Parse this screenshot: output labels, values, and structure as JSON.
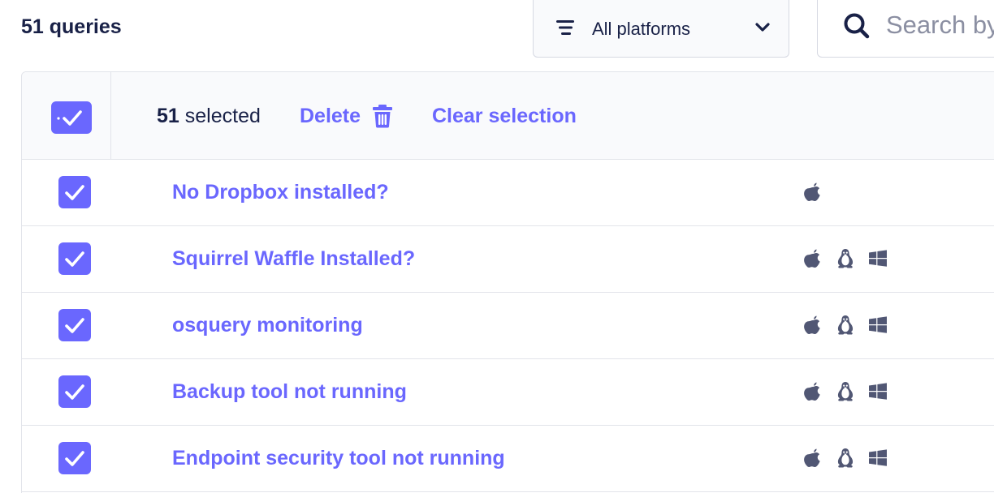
{
  "header": {
    "query_count": "51 queries"
  },
  "platform_filter": {
    "selected": "All platforms",
    "icon": "filter-lines-icon",
    "chevron": "chevron-down-icon"
  },
  "search": {
    "placeholder": "Search by name",
    "icon": "search-icon"
  },
  "bulk_actions": {
    "selected_number": "51",
    "selected_text": " selected",
    "delete_label": "Delete",
    "clear_label": "Clear selection"
  },
  "colors": {
    "accent": "#6a67fe",
    "text": "#192147",
    "border": "#e2e4ea",
    "header_bg": "#f9fafc",
    "icon": "#515774"
  },
  "rows": [
    {
      "name": "No Dropbox installed?",
      "platforms": [
        "apple-icon"
      ]
    },
    {
      "name": "Squirrel Waffle Installed?",
      "platforms": [
        "apple-icon",
        "linux-icon",
        "windows-icon"
      ]
    },
    {
      "name": "osquery monitoring",
      "platforms": [
        "apple-icon",
        "linux-icon",
        "windows-icon"
      ]
    },
    {
      "name": "Backup tool not running",
      "platforms": [
        "apple-icon",
        "linux-icon",
        "windows-icon"
      ]
    },
    {
      "name": "Endpoint security tool not running",
      "platforms": [
        "apple-icon",
        "linux-icon",
        "windows-icon"
      ]
    }
  ]
}
